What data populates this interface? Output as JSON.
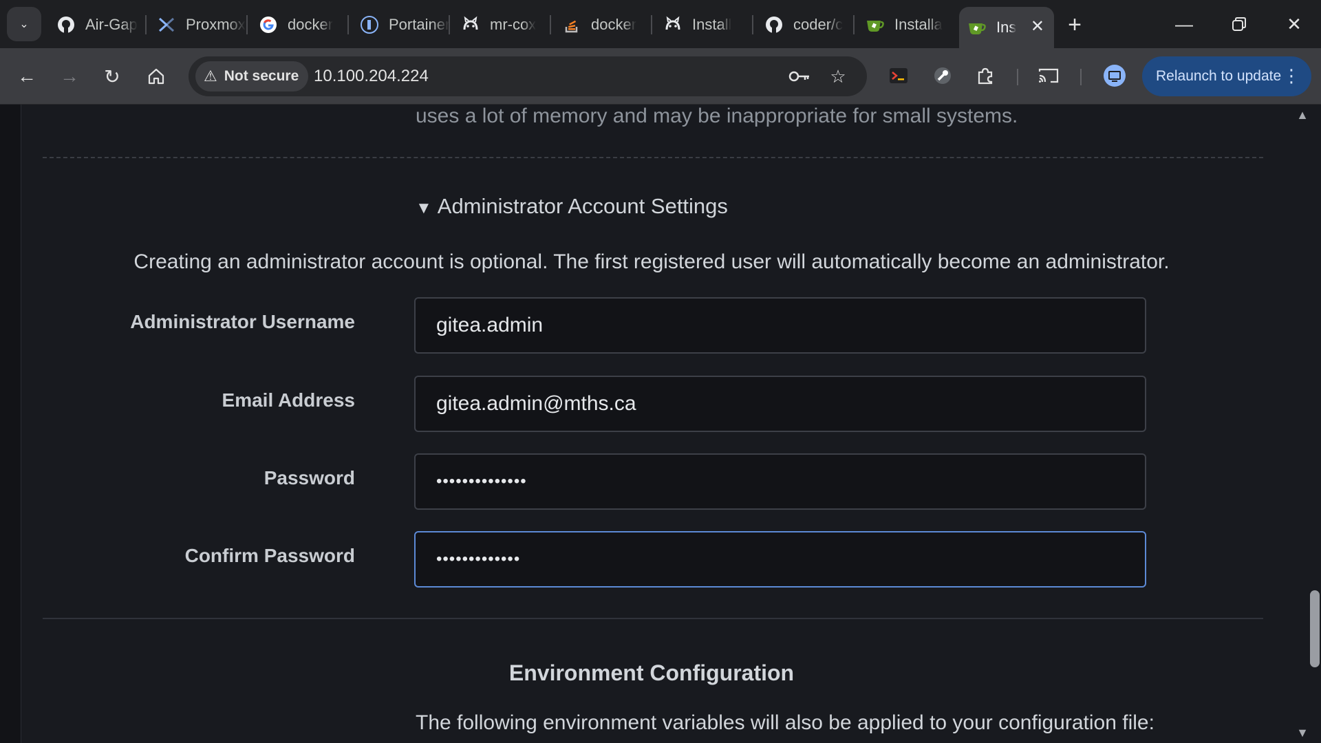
{
  "tabs": [
    {
      "label": "Air-Gap",
      "icon": "github-icon"
    },
    {
      "label": "Proxmox",
      "icon": "proxmox-icon"
    },
    {
      "label": "docker",
      "icon": "google-icon"
    },
    {
      "label": "Portainer",
      "icon": "portainer-icon"
    },
    {
      "label": "mr-cox",
      "icon": "github-octocat-icon"
    },
    {
      "label": "docker",
      "icon": "stackoverflow-icon"
    },
    {
      "label": "Install",
      "icon": "github-octocat-icon"
    },
    {
      "label": "coder/c",
      "icon": "github-icon"
    },
    {
      "label": "Installa",
      "icon": "gitea-icon"
    },
    {
      "label": "Ins",
      "icon": "gitea-icon",
      "active": true
    }
  ],
  "toolbar": {
    "security_label": "Not secure",
    "url": "10.100.204.224",
    "relaunch_label": "Relaunch to update"
  },
  "page": {
    "help_text_top": "uses a lot of memory and may be inappropriate for small systems.",
    "admin_section_title": "Administrator Account Settings",
    "admin_section_desc": "Creating an administrator account is optional. The first registered user will automatically become an administrator.",
    "fields": {
      "username": {
        "label": "Administrator Username",
        "value": "gitea.admin"
      },
      "email": {
        "label": "Email Address",
        "value": "gitea.admin@mths.ca"
      },
      "password": {
        "label": "Password",
        "value": "••••••••••••••"
      },
      "confirm": {
        "label": "Confirm Password",
        "value": "•••••••••••••"
      }
    },
    "env_title": "Environment Configuration",
    "env_desc": "The following environment variables will also be applied to your configuration file:"
  },
  "colors": {
    "accent": "#5c8ad6",
    "relaunch_bg": "#1f4a83",
    "page_bg": "#181a1f"
  }
}
